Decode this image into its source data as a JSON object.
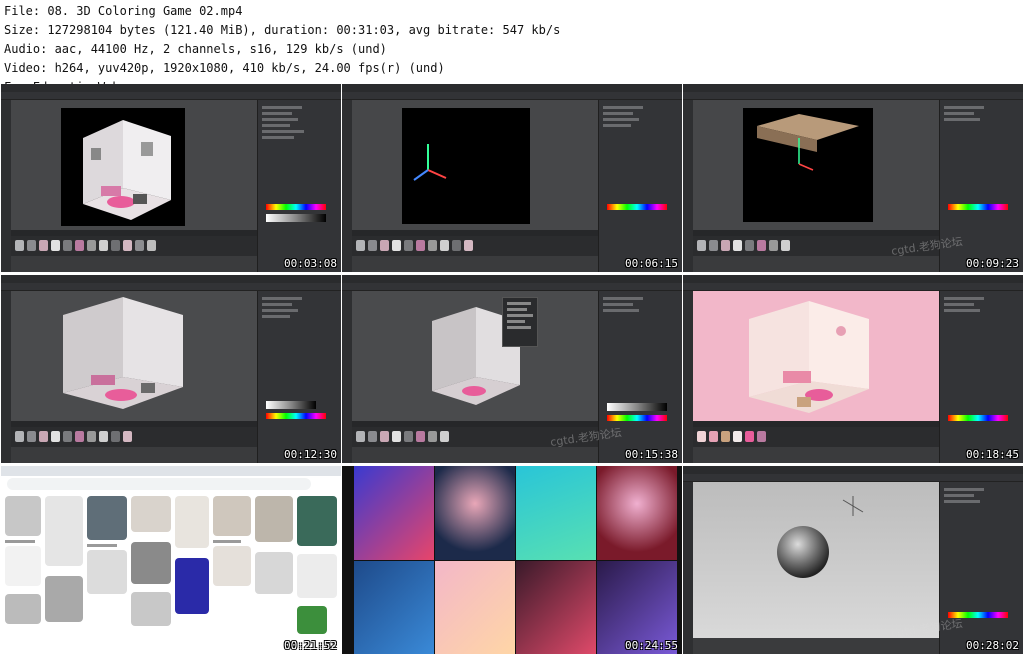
{
  "header": {
    "file_line": "File: 08. 3D Coloring Game 02.mp4",
    "size_line": "Size: 127298104 bytes (121.40 MiB), duration: 00:31:03, avg bitrate: 547 kb/s",
    "audio_line": "Audio: aac, 44100 Hz, 2 channels, s16, 129 kb/s (und)",
    "video_line": "Video: h264, yuv420p, 1920x1080, 410 kb/s, 24.00 fps(r) (und)",
    "site_line": "FreeEducationWeb.com"
  },
  "thumbnails": [
    {
      "timestamp": "00:03:08",
      "scene": "room-render"
    },
    {
      "timestamp": "00:06:15",
      "scene": "black-canvas-axes"
    },
    {
      "timestamp": "00:09:23",
      "scene": "black-canvas-shelf"
    },
    {
      "timestamp": "00:12:30",
      "scene": "room-wireframe"
    },
    {
      "timestamp": "00:15:38",
      "scene": "room-menu"
    },
    {
      "timestamp": "00:18:45",
      "scene": "room-pink-render"
    },
    {
      "timestamp": "00:21:52",
      "scene": "browser-pinterest"
    },
    {
      "timestamp": "00:24:55",
      "scene": "art-grid"
    },
    {
      "timestamp": "00:28:02",
      "scene": "sphere-viewport"
    }
  ],
  "watermark": "cgtd.老狗论坛",
  "colors": {
    "app_bg": "#3a3b3d",
    "pink_bg": "#f2b7c9",
    "accent_pink": "#e85d9a"
  }
}
